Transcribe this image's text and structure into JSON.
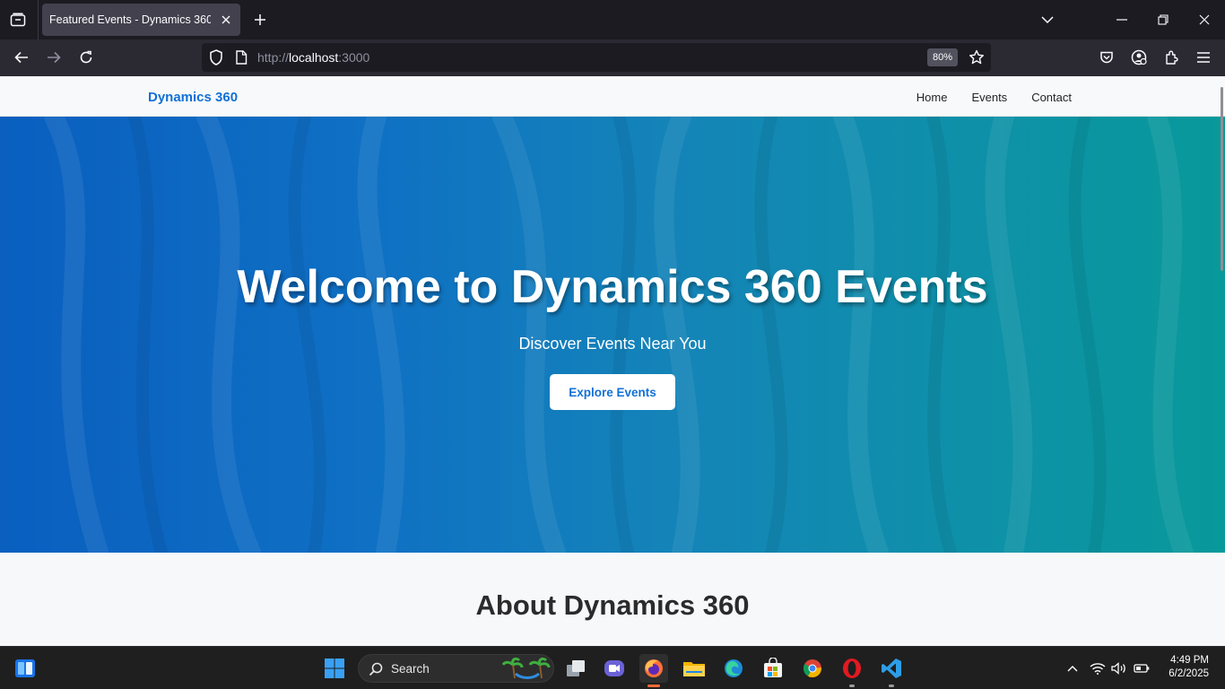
{
  "browser": {
    "tab_title": "Featured Events - Dynamics 360",
    "url_scheme": "http://",
    "url_host": "localhost",
    "url_port": ":3000",
    "zoom_level": "80%"
  },
  "site": {
    "brand": "Dynamics 360",
    "nav": {
      "home": "Home",
      "events": "Events",
      "contact": "Contact"
    },
    "hero": {
      "title": "Welcome to Dynamics 360 Events",
      "subtitle": "Discover Events Near You",
      "cta_label": "Explore Events"
    },
    "about_title": "About Dynamics 360"
  },
  "taskbar": {
    "search_label": "Search",
    "time": "4:49 PM",
    "date": "6/2/2025"
  },
  "colors": {
    "brand_blue": "#1170d6",
    "hero_gradient_start": "#0a5fbf",
    "hero_gradient_end": "#08999a"
  }
}
